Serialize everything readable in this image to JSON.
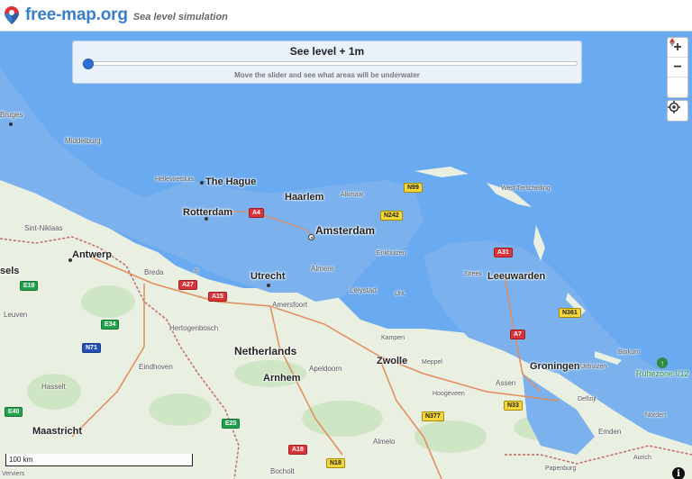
{
  "header": {
    "title": "free-map.org",
    "subtitle": "Sea level simulation"
  },
  "panel": {
    "title": "See level + 1m",
    "hint": "Move the slider and see what areas will be underwater",
    "slider_value": 1,
    "slider_fraction": 0.0
  },
  "controls": {
    "zoom_in": "+",
    "zoom_out": "−",
    "compass": "▲▼",
    "info": "i"
  },
  "scale": {
    "label": "100 km"
  },
  "colors": {
    "water": "#6aaaf0",
    "flooded": "#7bb2ee",
    "land": "#e9efe1",
    "forest": "#cfe6c4",
    "border": "#c46a6a",
    "accent": "#2b6fd6"
  },
  "places": {
    "bruges": "Bruges",
    "middelburg": "Middelburg",
    "hellevoetsluis": "Hellevoetsluis",
    "the_hague": "The Hague",
    "haarlem": "Haarlem",
    "alkmaar": "Alkmaar",
    "rotterdam": "Rotterdam",
    "amsterdam": "Amsterdam",
    "sint_niklaas": "Sint-Niklaas",
    "antwerp": "Antwerp",
    "breda": "Breda",
    "utrecht": "Utrecht",
    "almere": "Almere",
    "lelystad": "Lelystad",
    "urk": "Urk",
    "enkhuizen": "Enkhuizen",
    "west_terschelling": "West\nTerschelling",
    "sneek": "Sneek",
    "leeuwarden": "Leeuwarden",
    "amersfoort": "Amersfoort",
    "hertogenbosch": "Hertogenbosch",
    "leuven": "Leuven",
    "eindhoven": "Eindhoven",
    "netherlands": "Netherlands",
    "arnhem": "Arnhem",
    "apeldoorn": "Apeldoorn",
    "kampen": "Kampen",
    "zwolle": "Zwolle",
    "meppel": "Meppel",
    "groningen": "Groningen",
    "uithuizen": "Uithuizen",
    "hasselt": "Hasselt",
    "hoogeveen": "Hoogeveen",
    "assen": "Assen",
    "delfzijl": "Delfzijl",
    "borkum": "Borkum",
    "ruhezone": "Ruhezone I/12",
    "norden": "Norden",
    "emden": "Emden",
    "aurich": "Aurich",
    "maastricht": "Maastricht",
    "verviers": "Verviers",
    "almelo": "Almelo",
    "bocholt": "Bocholt",
    "papenburg": "Papenburg",
    "sels": "sels",
    "s_marker": "s"
  },
  "roads": {
    "n99": "N99",
    "a4": "A4",
    "n242": "N242",
    "a31": "A31",
    "e19": "E19",
    "a27": "A27",
    "a15": "A15",
    "e34": "E34",
    "n71": "N71",
    "n361": "N361",
    "a7": "A7",
    "n377": "N377",
    "n33": "N33",
    "e40": "E40",
    "a18": "A18",
    "n18": "N18",
    "e25": "E25"
  }
}
